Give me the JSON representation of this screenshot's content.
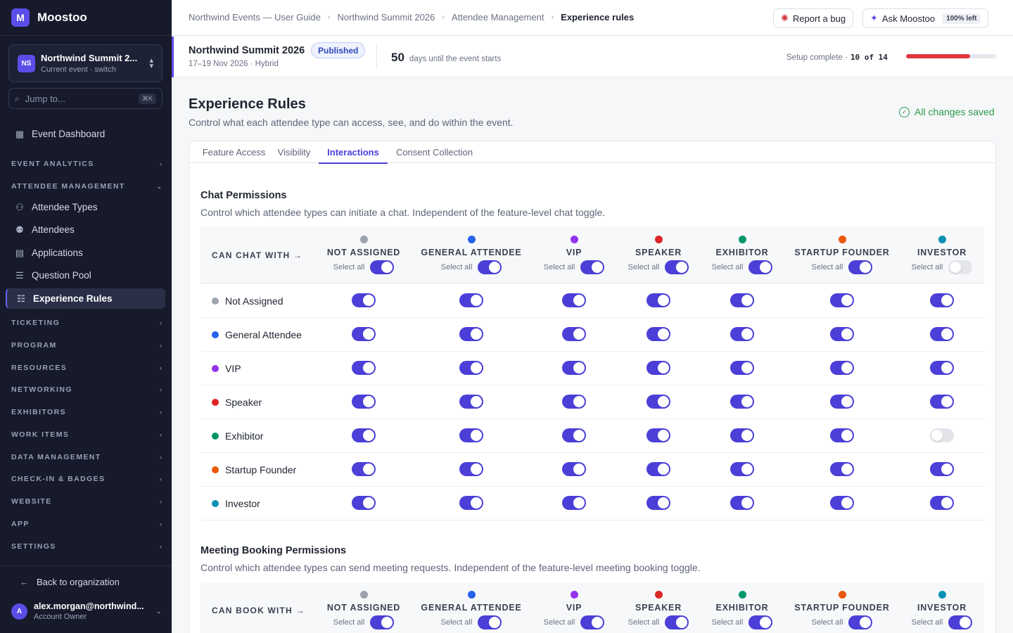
{
  "app": {
    "name": "Moostoo",
    "logo_letter": "M"
  },
  "event_switcher": {
    "initials": "NS",
    "name": "Northwind Summit 2...",
    "subtitle": "Current event · switch"
  },
  "jump": {
    "placeholder": "Jump to...",
    "shortcut": "⌘K"
  },
  "sidebar": {
    "dashboard": "Event Dashboard",
    "sections": {
      "event_analytics": "EVENT ANALYTICS",
      "attendee_management": "ATTENDEE MANAGEMENT",
      "ticketing": "TICKETING",
      "program": "PROGRAM",
      "resources": "RESOURCES",
      "networking": "NETWORKING",
      "exhibitors": "EXHIBITORS",
      "work_items": "WORK ITEMS",
      "data_management": "DATA MANAGEMENT",
      "checkin": "CHECK-IN & BADGES",
      "website": "WEBSITE",
      "app": "APP",
      "settings": "SETTINGS"
    },
    "attendee_items": [
      "Attendee Types",
      "Attendees",
      "Applications",
      "Question Pool",
      "Experience Rules"
    ],
    "back": "Back to organization",
    "user": {
      "initial": "A",
      "email": "alex.morgan@northwind...",
      "role": "Account Owner"
    }
  },
  "breadcrumbs": [
    "Northwind Events — User Guide",
    "Northwind Summit 2026",
    "Attendee Management",
    "Experience rules"
  ],
  "topbar": {
    "report_bug": "Report a bug",
    "ask": "Ask Moostoo",
    "ask_pill": "100% left"
  },
  "event": {
    "name": "Northwind Summit 2026",
    "status": "Published",
    "dates": "17–19 Nov 2026 · Hybrid",
    "days": "50",
    "days_label": "days until the event starts",
    "setup_label": "Setup complete ·",
    "setup_value": "10 of 14",
    "setup_progress": 0.714
  },
  "page": {
    "title": "Experience Rules",
    "subtitle": "Control what each attendee type can access, see, and do within the event.",
    "saved": "All changes saved"
  },
  "tabs": [
    "Feature Access",
    "Visibility",
    "Interactions",
    "Consent Collection"
  ],
  "select_all_label": "Select all",
  "types": [
    {
      "label": "Not Assigned",
      "header": "NOT ASSIGNED",
      "color": "#9ca3af"
    },
    {
      "label": "General Attendee",
      "header": "GENERAL ATTENDEE",
      "color": "#2563eb"
    },
    {
      "label": "VIP",
      "header": "VIP",
      "color": "#9333ea"
    },
    {
      "label": "Speaker",
      "header": "SPEAKER",
      "color": "#dc2626"
    },
    {
      "label": "Exhibitor",
      "header": "EXHIBITOR",
      "color": "#059669"
    },
    {
      "label": "Startup Founder",
      "header": "STARTUP FOUNDER",
      "color": "#ea580c"
    },
    {
      "label": "Investor",
      "header": "INVESTOR",
      "color": "#0891b2"
    }
  ],
  "chat": {
    "title": "Chat Permissions",
    "subtitle": "Control which attendee types can initiate a chat. Independent of the feature-level chat toggle.",
    "axis": "CAN CHAT WITH →",
    "select_all": [
      true,
      true,
      true,
      true,
      true,
      true,
      false
    ],
    "matrix": [
      [
        true,
        true,
        true,
        true,
        true,
        true,
        true
      ],
      [
        true,
        true,
        true,
        true,
        true,
        true,
        true
      ],
      [
        true,
        true,
        true,
        true,
        true,
        true,
        true
      ],
      [
        true,
        true,
        true,
        true,
        true,
        true,
        true
      ],
      [
        true,
        true,
        true,
        true,
        true,
        true,
        false
      ],
      [
        true,
        true,
        true,
        true,
        true,
        true,
        true
      ],
      [
        true,
        true,
        true,
        true,
        true,
        true,
        true
      ]
    ]
  },
  "meeting": {
    "title": "Meeting Booking Permissions",
    "subtitle": "Control which attendee types can send meeting requests. Independent of the feature-level meeting booking toggle.",
    "axis": "CAN BOOK WITH →",
    "select_all": [
      true,
      true,
      true,
      true,
      true,
      true,
      true
    ]
  }
}
